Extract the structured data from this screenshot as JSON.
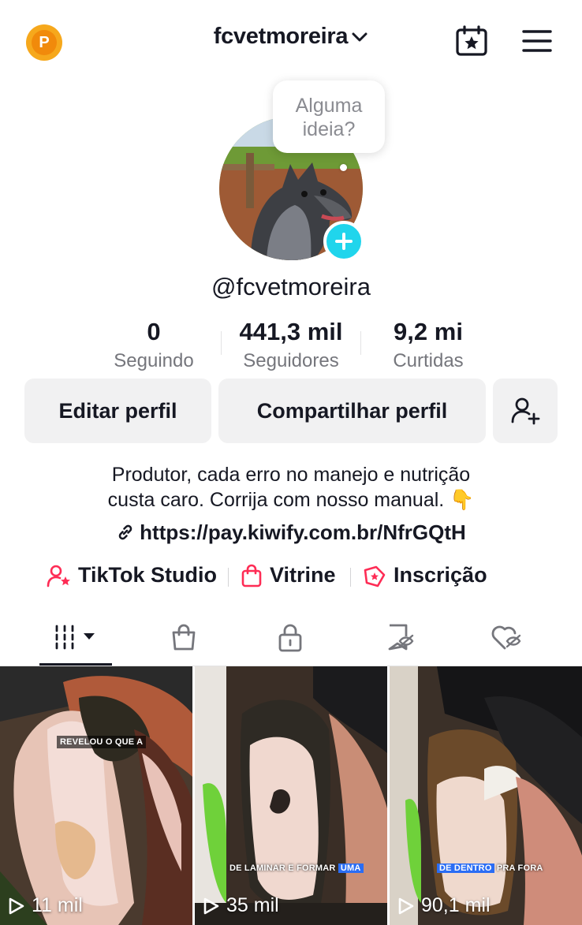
{
  "header": {
    "account_name": "fcvetmoreira",
    "coin_letter": "P"
  },
  "profile": {
    "tooltip": "Alguma ideia?",
    "handle": "@fcvetmoreira",
    "stats": [
      {
        "value": "0",
        "label": "Seguindo"
      },
      {
        "value": "441,3 mil",
        "label": "Seguidores"
      },
      {
        "value": "9,2 mi",
        "label": "Curtidas"
      }
    ],
    "buttons": {
      "edit": "Editar perfil",
      "share": "Compartilhar perfil"
    },
    "bio_line1": "Produtor, cada erro no manejo e nutrição",
    "bio_line2": "custa caro. Corrija com nosso manual. 👇",
    "link": "https://pay.kiwify.com.br/NfrGQtH"
  },
  "shortcuts": [
    {
      "label": "TikTok Studio",
      "icon": "studio-icon"
    },
    {
      "label": "Vitrine",
      "icon": "shopping-bag-icon"
    },
    {
      "label": "Inscrição",
      "icon": "subscription-icon"
    }
  ],
  "tabs": [
    "videos-grid-icon",
    "shop-icon",
    "lock-icon",
    "reposts-icon",
    "liked-icon"
  ],
  "videos": [
    {
      "views": "11 mil",
      "caption": "REVELOU O QUE A"
    },
    {
      "views": "35 mil",
      "caption_plain": "DE LAMINAR E FORMAR",
      "caption_highlight": "UMA"
    },
    {
      "views": "90,1 mil",
      "caption_plain2": "PRA FORA",
      "caption_highlight": "DE DENTRO"
    }
  ],
  "colors": {
    "accent_cyan": "#20d5ec",
    "brand_pink": "#fe2c55",
    "caption_blue": "#2a6df4"
  }
}
